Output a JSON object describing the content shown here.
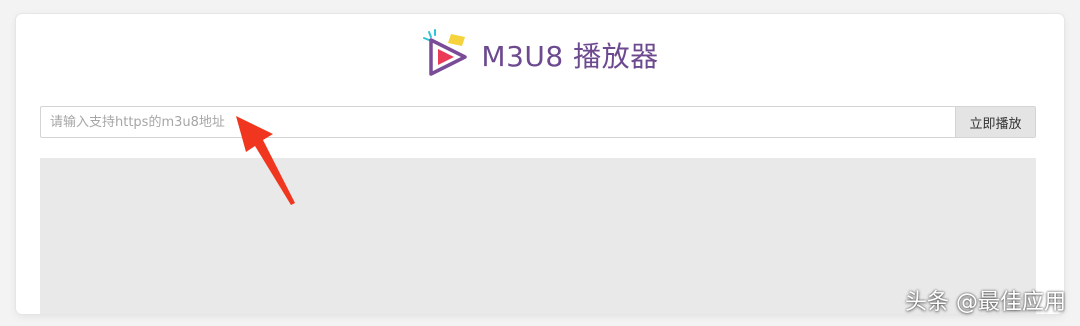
{
  "app": {
    "title": "M3U8 播放器",
    "logo_icon": "play-logo-icon",
    "accent_color": "#6d4a8f"
  },
  "url_bar": {
    "placeholder": "请输入支持https的m3u8地址",
    "value": "",
    "button_label": "立即播放"
  },
  "annotation": {
    "arrow_color": "#f0361f"
  },
  "watermark": "头条 @最佳应用"
}
